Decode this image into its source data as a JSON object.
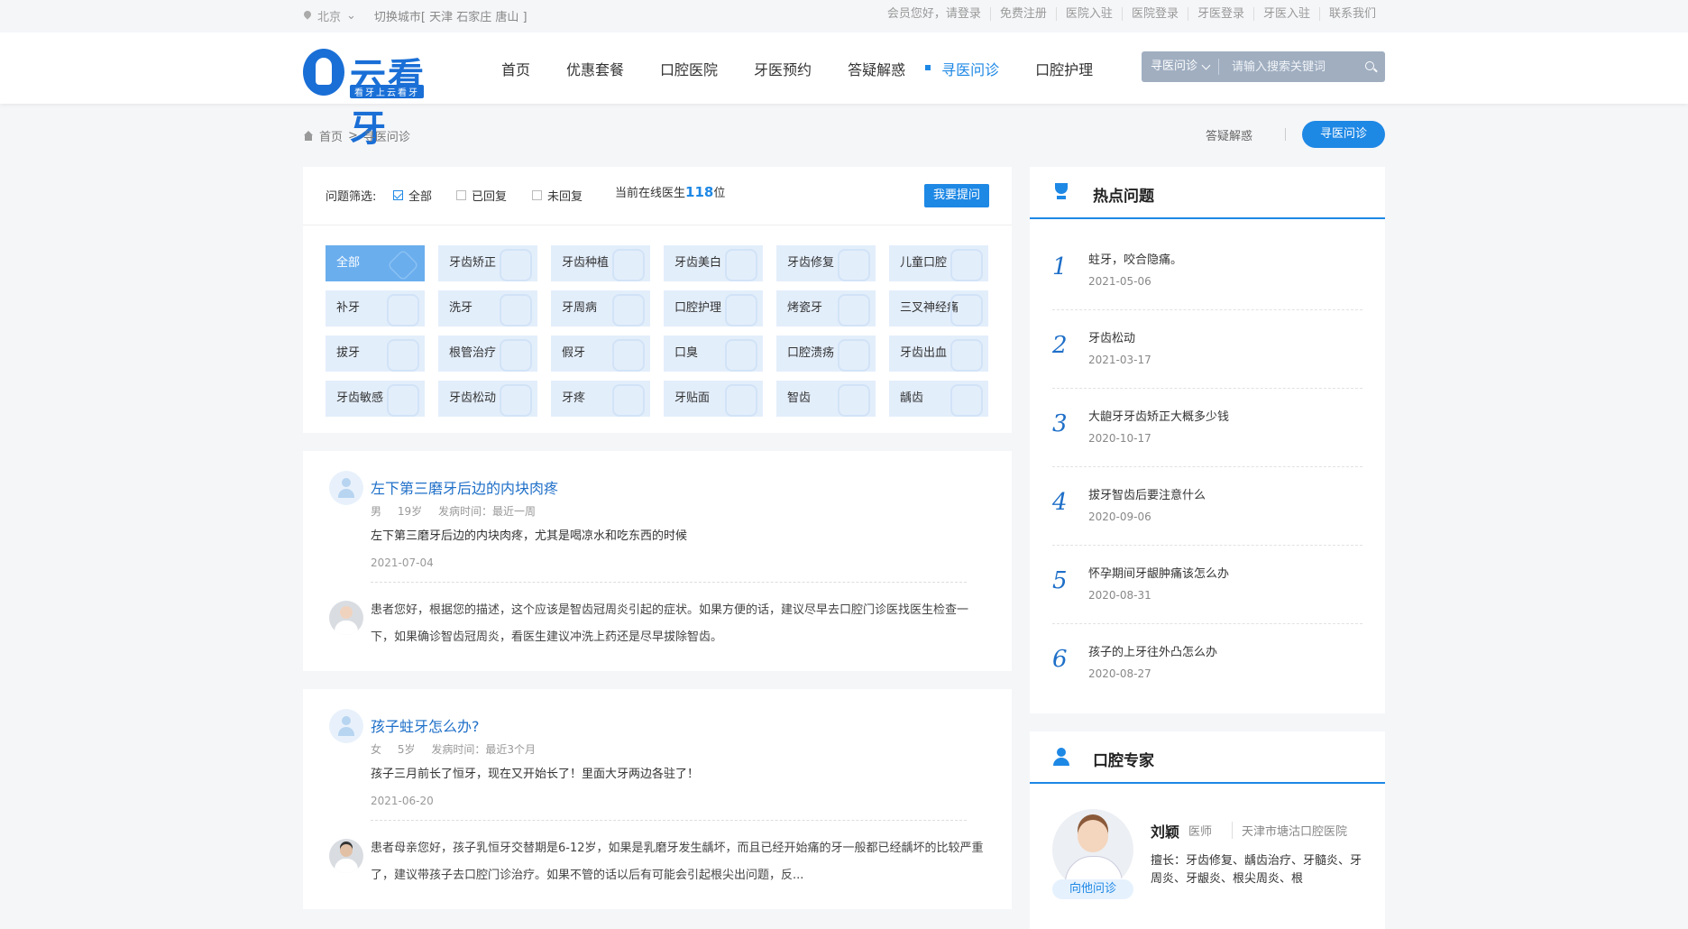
{
  "topbar": {
    "location": "北京",
    "switch_city": "切换城市[ 天津  石家庄  唐山 ]",
    "links": [
      "会员您好，请登录",
      "免费注册",
      "医院入驻",
      "医院登录",
      "牙医登录",
      "牙医入驻",
      "联系我们"
    ]
  },
  "header": {
    "logo_text": "云看牙",
    "logo_slogan": "看牙上云看牙",
    "nav": [
      "首页",
      "优惠套餐",
      "口腔医院",
      "牙医预约",
      "答疑解惑",
      "寻医问诊",
      "口腔护理"
    ],
    "active_nav": "寻医问诊",
    "search_type": "寻医问诊",
    "search_placeholder": "请输入搜索关键词"
  },
  "breadcrumb": {
    "home": "首页",
    "separator": ">",
    "current": "寻医问诊"
  },
  "right_tabs": {
    "tab1": "答疑解惑",
    "tab2": "寻医问诊"
  },
  "filter": {
    "label": "问题筛选:",
    "options": [
      "全部",
      "已回复",
      "未回复"
    ],
    "online_prefix": "当前在线医生",
    "online_count": "118",
    "online_suffix": "位",
    "ask_button": "我要提问",
    "categories": [
      "全部",
      "牙齿矫正",
      "牙齿种植",
      "牙齿美白",
      "牙齿修复",
      "儿童口腔",
      "补牙",
      "洗牙",
      "牙周病",
      "口腔护理",
      "烤瓷牙",
      "三叉神经痛",
      "拔牙",
      "根管治疗",
      "假牙",
      "口臭",
      "口腔溃疡",
      "牙齿出血",
      "牙齿敏感",
      "牙齿松动",
      "牙疼",
      "牙贴面",
      "智齿",
      "龋齿"
    ]
  },
  "questions": [
    {
      "title": "左下第三磨牙后边的内块肉疼",
      "gender": "男",
      "age": "19岁",
      "duration": "发病时间：最近一周",
      "desc": "左下第三磨牙后边的内块肉疼，尤其是喝凉水和吃东西的时候",
      "date": "2021-07-04",
      "answer": "患者您好，根据您的描述，这个应该是智齿冠周炎引起的症状。如果方便的话，建议尽早去口腔门诊医找医生检查一下，如果确诊智齿冠周炎，看医生建议冲洗上药还是尽早拔除智齿。"
    },
    {
      "title": "孩子蛀牙怎么办?",
      "gender": "女",
      "age": "5岁",
      "duration": "发病时间：最近3个月",
      "desc": "孩子三月前长了恒牙，现在又开始长了！里面大牙两边各驻了！",
      "date": "2021-06-20",
      "answer": "患者母亲您好，孩子乳恒牙交替期是6-12岁，如果是乳磨牙发生龋坏，而且已经开始痛的牙一般都已经龋坏的比较严重了，建议带孩子去口腔门诊治疗。如果不管的话以后有可能会引起根尖出问题，反..."
    }
  ],
  "hot": {
    "title": "热点问题",
    "items": [
      {
        "n": "1",
        "t": "蛀牙，咬合隐痛。",
        "d": "2021-05-06"
      },
      {
        "n": "2",
        "t": "牙齿松动",
        "d": "2021-03-17"
      },
      {
        "n": "3",
        "t": "大龅牙牙齿矫正大概多少钱",
        "d": "2020-10-17"
      },
      {
        "n": "4",
        "t": "拔牙智齿后要注意什么",
        "d": "2020-09-06"
      },
      {
        "n": "5",
        "t": "怀孕期间牙龈肿痛该怎么办",
        "d": "2020-08-31"
      },
      {
        "n": "6",
        "t": "孩子的上牙往外凸怎么办",
        "d": "2020-08-27"
      }
    ]
  },
  "expert": {
    "title": "口腔专家",
    "name": "刘颖",
    "role": "医师",
    "hospital": "天津市塘沽口腔医院",
    "ask_label": "向他问诊",
    "specialty": "擅长：牙齿修复、龋齿治疗、牙髓炎、牙周炎、牙龈炎、根尖周炎、根"
  }
}
